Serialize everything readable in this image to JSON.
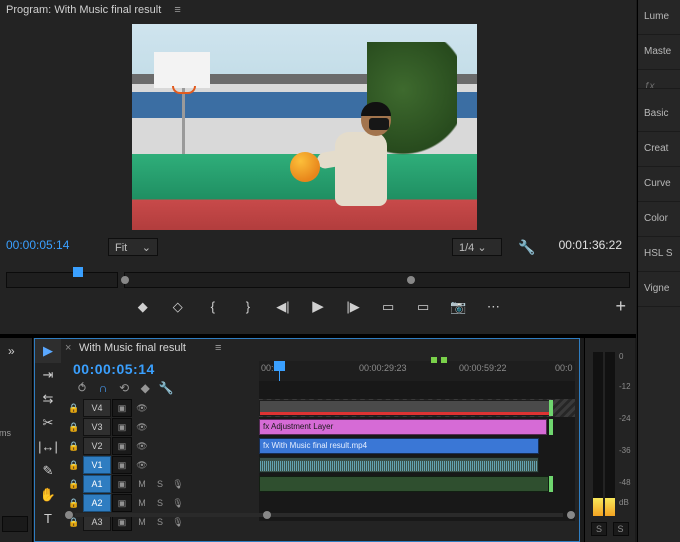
{
  "program": {
    "panel_title_prefix": "Program:",
    "sequence_name": "With Music final result",
    "hamburger": "≡",
    "current_tc": "00:00:05:14",
    "fit_label": "Fit",
    "quality_label": "1/4",
    "duration_tc": "00:01:36:22",
    "transport": {
      "mark_in": "◆",
      "mark_out": "◇",
      "go_in": "{",
      "go_out": "}",
      "step_back": "◀|",
      "play": "▶",
      "step_fwd": "|▶",
      "lift": "▭",
      "extract": "▭",
      "export_frame": "📷",
      "more": "⋯",
      "add": "+"
    }
  },
  "rhs": {
    "items": [
      "Lume",
      "Maste",
      "ƒx",
      "Basic",
      "Creat",
      "Curve",
      "Color",
      "HSL S",
      "Vigne"
    ]
  },
  "leftcol": {
    "expand": "»",
    "label": "ems"
  },
  "timeline": {
    "close": "×",
    "name": "With Music final result",
    "hamburger": "≡",
    "current_tc": "00:00:05:14",
    "opts": {
      "insert": "⥀",
      "snap": "∩",
      "link": "⟲",
      "marker": "◆",
      "wrench": "🔧"
    },
    "ruler": {
      "t0": "00:00",
      "t1": "00:00:29:23",
      "t2": "00:00:59:22",
      "t3": "00:0"
    },
    "tools": {
      "selection": "▶",
      "track_select": "⇥",
      "ripple": "⇆",
      "razor": "✂",
      "slip": "|↔|",
      "pen": "✎",
      "hand": "✋",
      "type": "T"
    },
    "tracks": {
      "v4": {
        "name": "V4",
        "lock": "🔒",
        "toggle": "▣",
        "eye": "👁"
      },
      "v3": {
        "name": "V3",
        "lock": "🔒",
        "toggle": "▣",
        "eye": "👁"
      },
      "v2": {
        "name": "V2",
        "lock": "🔒",
        "toggle": "▣",
        "eye": "👁",
        "clip_label": "fx  Adjustment Layer"
      },
      "v1": {
        "name": "V1",
        "lock": "🔒",
        "toggle": "▣",
        "eye": "👁",
        "clip_label": "fx  With Music final result.mp4"
      },
      "a1": {
        "name": "A1",
        "lock": "🔒",
        "toggle": "▣",
        "m": "M",
        "s": "S",
        "mic": "🎙"
      },
      "a2": {
        "name": "A2",
        "lock": "🔒",
        "toggle": "▣",
        "m": "M",
        "s": "S",
        "mic": "🎙"
      },
      "a3": {
        "name": "A3",
        "lock": "🔒",
        "toggle": "▣",
        "m": "M",
        "s": "S",
        "mic": "🎙"
      }
    }
  },
  "meters": {
    "labels": [
      "0",
      "-12",
      "-24",
      "-36",
      "-48",
      "dB"
    ],
    "solo": "S"
  }
}
